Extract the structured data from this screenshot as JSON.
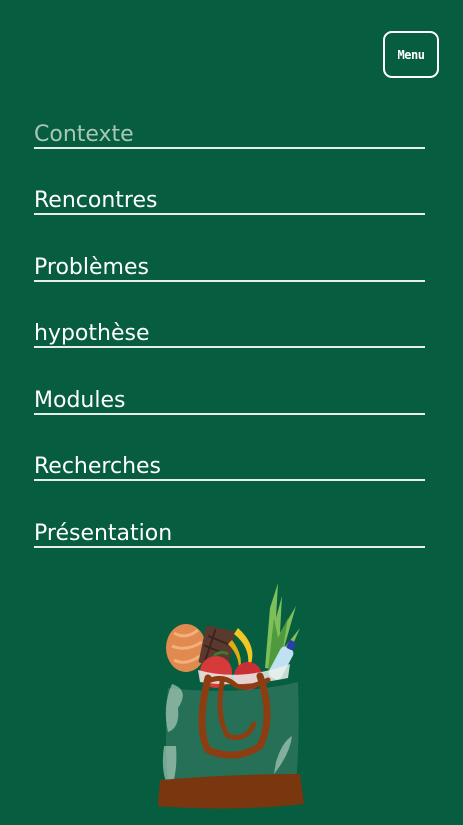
{
  "header": {
    "menu_label": "Menu"
  },
  "nav": {
    "items": [
      {
        "label": "Contexte",
        "active": true
      },
      {
        "label": "Rencontres",
        "active": false
      },
      {
        "label": "Problèmes",
        "active": false
      },
      {
        "label": "hypothèse",
        "active": false
      },
      {
        "label": "Modules",
        "active": false
      },
      {
        "label": "Recherches",
        "active": false
      },
      {
        "label": "Présentation",
        "active": false
      }
    ]
  },
  "colors": {
    "background": "#075d3f",
    "text": "#ffffff",
    "active_text": "#a7c7b8",
    "underline": "#e8ecea"
  },
  "illustration": {
    "icon": "grocery-bag-illustration"
  }
}
